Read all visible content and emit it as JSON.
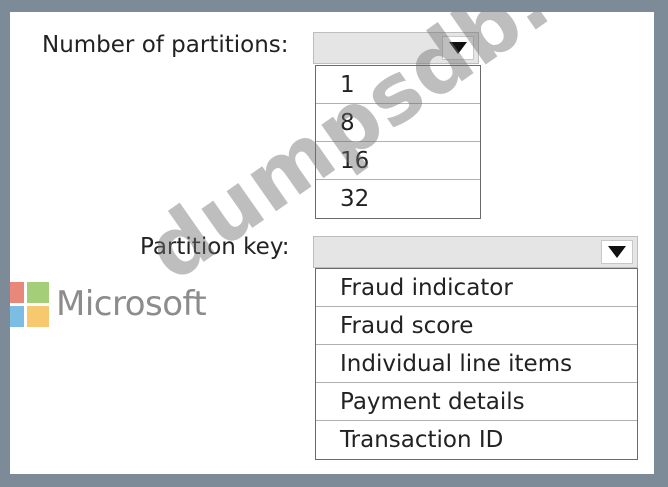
{
  "partitions": {
    "label": "Number of partitions:",
    "selected": "",
    "options": [
      "1",
      "8",
      "16",
      "32"
    ]
  },
  "partition_key": {
    "label": "Partition key:",
    "selected": "",
    "options": [
      "Fraud indicator",
      "Fraud score",
      "Individual line items",
      "Payment details",
      "Transaction ID"
    ]
  },
  "branding": {
    "microsoft_text": "Microsoft",
    "watermark_text": "dumpsdb.com",
    "logo_colors": [
      "#f25022",
      "#7fba00",
      "#00a4ef",
      "#ffb900"
    ]
  },
  "icons": {
    "dropdown_arrow": "triangle-down-icon"
  }
}
